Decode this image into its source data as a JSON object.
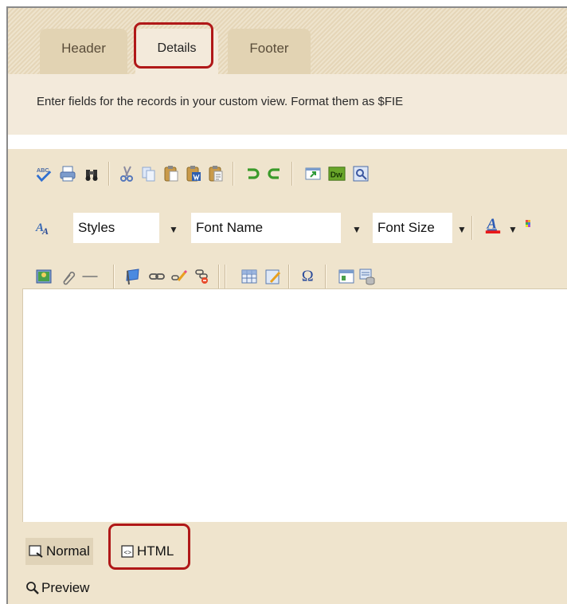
{
  "tabs": [
    {
      "label": "Header",
      "active": false
    },
    {
      "label": "Details",
      "active": true
    },
    {
      "label": "Footer",
      "active": false
    }
  ],
  "instructions": "Enter fields for the records in your custom view. Format them as $FIE",
  "toolbar": {
    "styles_label": "Styles",
    "font_name_label": "Font Name",
    "font_size_label": "Font Size",
    "dw_label": "Dw",
    "abc_label": "ABC"
  },
  "modes": {
    "normal": "Normal",
    "html": "HTML",
    "preview": "Preview"
  },
  "colors": {
    "highlight": "#b01818",
    "panel": "#efe4cd",
    "tab": "#e2d3b3",
    "active_tab": "#f3eadb"
  }
}
